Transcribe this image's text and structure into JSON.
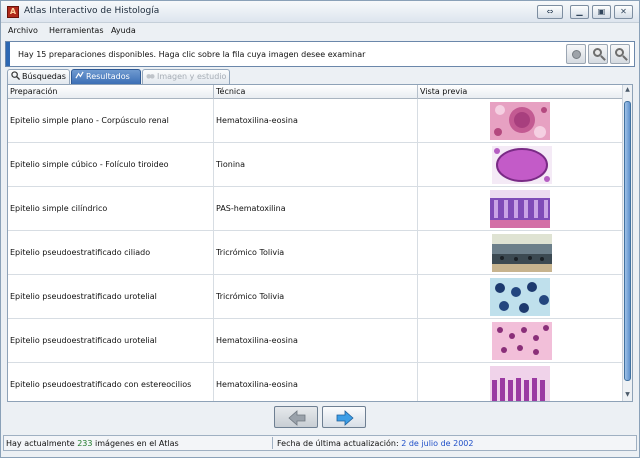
{
  "window": {
    "title": "Atlas Interactivo de Histología"
  },
  "menu": {
    "items": [
      "Archivo",
      "Herramientas",
      "Ayuda"
    ]
  },
  "info": {
    "text": "Hay 15 preparaciones disponibles. Haga clic sobre la fila cuya imagen desee examinar"
  },
  "tabs": [
    {
      "label": "Búsquedas",
      "state": "normal"
    },
    {
      "label": "Resultados",
      "state": "active"
    },
    {
      "label": "Imagen y estudio",
      "state": "disabled"
    }
  ],
  "table": {
    "columns": [
      "Preparación",
      "Técnica",
      "Vista previa"
    ],
    "rows": [
      {
        "preparation": "Epitelio simple plano - Corpúsculo renal",
        "technique": "Hematoxilina-eosina",
        "thumb": "hematoxylin-eosin-kidney"
      },
      {
        "preparation": "Epitelio simple cúbico - Folículo tiroideo",
        "technique": "Tionina",
        "thumb": "thionine-thyroid"
      },
      {
        "preparation": "Epitelio simple cilíndrico",
        "technique": "PAS-hematoxilina",
        "thumb": "pas-columnar"
      },
      {
        "preparation": "Epitelio pseudoestratificado ciliado",
        "technique": "Tricrómico Tolivia",
        "thumb": "trichrome-ciliated"
      },
      {
        "preparation": "Epitelio pseudoestratificado urotelial",
        "technique": "Tricrómico Tolivia",
        "thumb": "trichrome-urothelial"
      },
      {
        "preparation": "Epitelio pseudoestratificado urotelial",
        "technique": "Hematoxilina-eosina",
        "thumb": "he-urothelial"
      },
      {
        "preparation": "Epitelio pseudoestratificado con estereocilios",
        "technique": "Hematoxilina-eosina",
        "thumb": "he-stereocilia"
      }
    ]
  },
  "nav": {
    "back": "arrow-left-icon",
    "forward": "arrow-right-icon"
  },
  "status": {
    "images_prefix": "Hay actualmente ",
    "images_count": "233",
    "images_suffix": " imágenes en el Atlas",
    "update_label": "Fecha de última actualización: ",
    "update_date": "2 de julio de 2002"
  },
  "colors": {
    "accent": "#3c6fb5",
    "date": "#2050c8",
    "count": "#1f7a2a"
  }
}
